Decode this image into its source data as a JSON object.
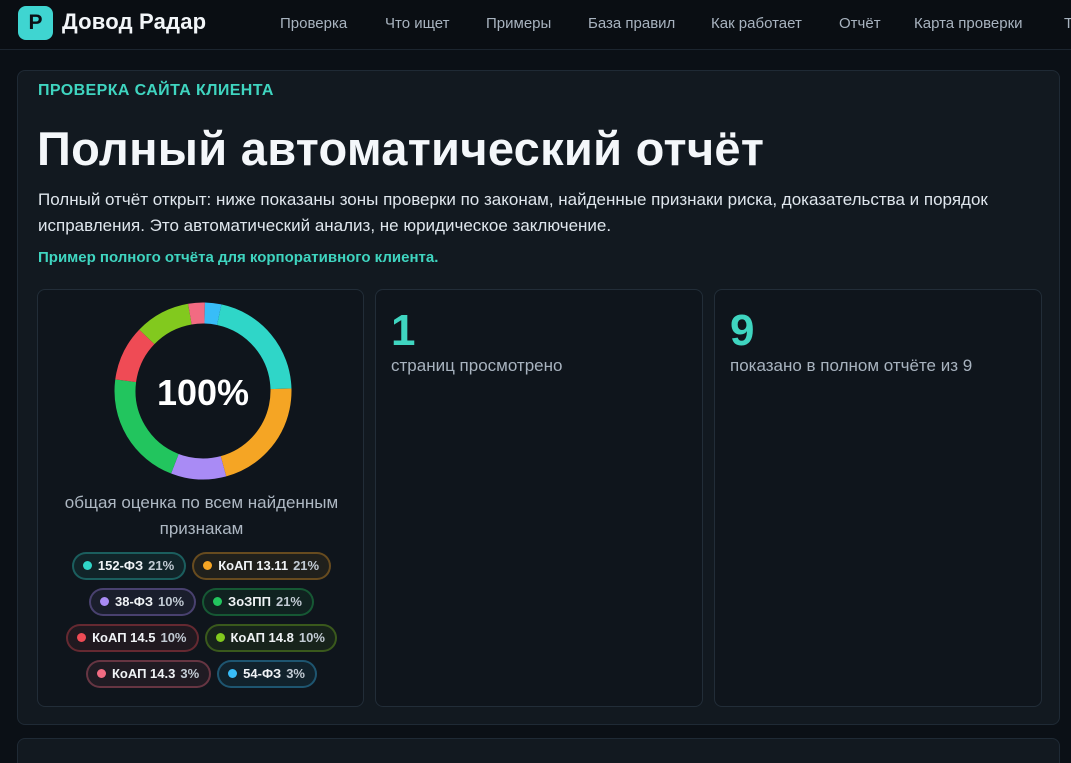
{
  "brand": {
    "logo_letter": "P",
    "name": "Довод Радар"
  },
  "nav": [
    "Проверка",
    "Что ищет",
    "Примеры",
    "База правил",
    "Как работает",
    "Отчёт",
    "Карта проверки",
    "Т"
  ],
  "report": {
    "eyebrow": "ПРОВЕРКА САЙТА КЛИЕНТА",
    "title": "Полный автоматический отчёт",
    "description": "Полный отчёт открыт: ниже показаны зоны проверки по законам, найденные признаки риска, доказательства и порядок исправления. Это автоматический анализ, не юридическое заключение.",
    "sample_note": "Пример полного отчёта для корпоративного клиента."
  },
  "score": {
    "value": "100%",
    "caption": "общая оценка по всем найденным признакам"
  },
  "chart_data": {
    "type": "pie",
    "variant": "donut",
    "center_label": "100%",
    "categories": [
      "152-ФЗ",
      "КоАП 13.11",
      "38-ФЗ",
      "ЗоЗПП",
      "КоАП 14.5",
      "КоАП 14.8",
      "КоАП 14.3",
      "54-ФЗ"
    ],
    "values": [
      21,
      21,
      10,
      21,
      10,
      10,
      3,
      3
    ],
    "value_labels": [
      "21%",
      "21%",
      "10%",
      "21%",
      "10%",
      "10%",
      "3%",
      "3%"
    ],
    "colors": [
      "#2fd6c8",
      "#f5a524",
      "#a98bf5",
      "#22c55e",
      "#ef4b55",
      "#82c91e",
      "#f26b82",
      "#38bdf8"
    ],
    "legend_placement": "bottom"
  },
  "stats": [
    {
      "number": "1",
      "label": "страниц просмотрено"
    },
    {
      "number": "9",
      "label": "показано в полном отчёте из 9"
    }
  ]
}
